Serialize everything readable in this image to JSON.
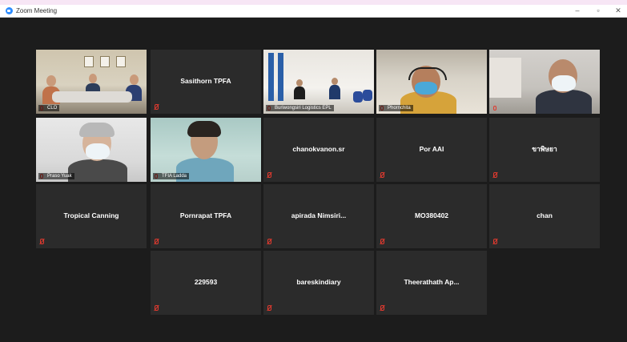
{
  "window": {
    "title": "Zoom Meeting",
    "minimize_glyph": "–",
    "maximize_glyph": "▫",
    "close_glyph": "✕"
  },
  "tiles": {
    "t01": {
      "label": "CLO"
    },
    "t02": {
      "name": "Sasithorn TPFA"
    },
    "t03": {
      "label": "Buriwongsiri Logistics EPL"
    },
    "t04": {
      "label": "Phornchita"
    },
    "t05": {
      "label": ""
    },
    "t06": {
      "label": "Praso Yuak"
    },
    "t07": {
      "label": "TFIA Ladda"
    },
    "t08": {
      "name": "chanokvanon.sr"
    },
    "t09": {
      "name": "Por AAI"
    },
    "t10": {
      "name": "ขาพิษยา"
    },
    "t11": {
      "name": "Tropical Canning"
    },
    "t12": {
      "name": "Pornrapat TPFA"
    },
    "t13": {
      "name": "apirada Nimsiri..."
    },
    "t14": {
      "name": "MO380402"
    },
    "t15": {
      "name": "chan"
    },
    "t16": {
      "name": "229593"
    },
    "t17": {
      "name": "bareskindiary"
    },
    "t18": {
      "name": "Theerathath Ap..."
    }
  },
  "colors": {
    "active_speaker": "#d7e83a",
    "muted_icon": "#e03a2f",
    "tile_bg": "#2b2b2b",
    "stage_bg": "#1c1c1c"
  },
  "icons": {
    "app": "zoom-logo-icon",
    "muted": "mic-muted-icon"
  }
}
